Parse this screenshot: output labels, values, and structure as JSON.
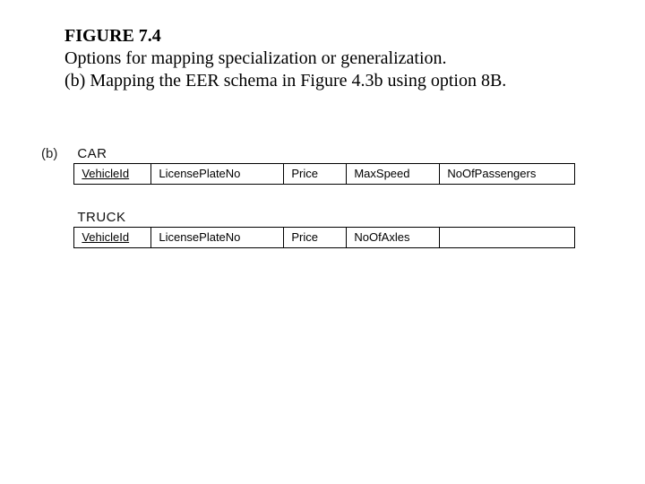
{
  "header": {
    "figure_label": "FIGURE 7.4",
    "title": "Options for mapping specialization or generalization.",
    "subtitle": " (b) Mapping the EER schema in Figure 4.3b using option 8B."
  },
  "part_label": "(b)",
  "schemas": {
    "car": {
      "name": "CAR",
      "columns": {
        "c1": "VehicleId",
        "c2": "LicensePlateNo",
        "c3": "Price",
        "c4": "MaxSpeed",
        "c5": "NoOfPassengers"
      }
    },
    "truck": {
      "name": "TRUCK",
      "columns": {
        "c1": "VehicleId",
        "c2": "LicensePlateNo",
        "c3": "Price",
        "c4": "NoOfAxles",
        "c5": ""
      }
    }
  }
}
